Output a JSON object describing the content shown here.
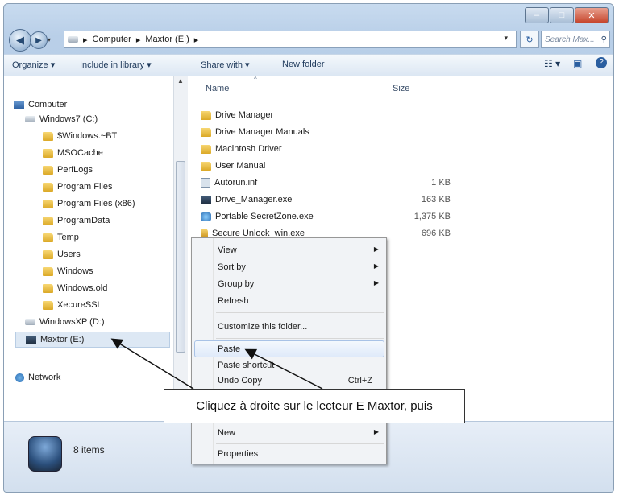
{
  "window": {
    "title_buttons": [
      "minimize",
      "maximize",
      "close"
    ]
  },
  "address_bar": {
    "crumbs": [
      "▸",
      "Computer",
      "▸",
      "Maxtor (E:)",
      "▸"
    ],
    "search_placeholder": "Search Max..."
  },
  "toolbar": {
    "organize": "Organize ▾",
    "include": "Include in library ▾",
    "share": "Share with ▾",
    "new_folder": "New folder"
  },
  "nav": {
    "items": [
      {
        "label": "Computer",
        "icon": "computer-icon"
      },
      {
        "label": "Windows7 (C:)",
        "icon": "drive-icon"
      },
      {
        "label": "$Windows.~BT",
        "icon": "folder-icon"
      },
      {
        "label": "MSOCache",
        "icon": "folder-icon"
      },
      {
        "label": "PerfLogs",
        "icon": "folder-icon"
      },
      {
        "label": "Program Files",
        "icon": "folder-icon"
      },
      {
        "label": "Program Files (x86)",
        "icon": "folder-icon"
      },
      {
        "label": "ProgramData",
        "icon": "folder-icon"
      },
      {
        "label": "Temp",
        "icon": "folder-icon"
      },
      {
        "label": "Users",
        "icon": "folder-icon"
      },
      {
        "label": "Windows",
        "icon": "folder-icon"
      },
      {
        "label": "Windows.old",
        "icon": "folder-icon"
      },
      {
        "label": "XecureSSL",
        "icon": "folder-icon"
      },
      {
        "label": "WindowsXP (D:)",
        "icon": "drive-icon"
      },
      {
        "label": "Maxtor (E:)",
        "icon": "drive-icon"
      },
      {
        "label": "Network",
        "icon": "network-icon"
      }
    ]
  },
  "files": {
    "col_name": "Name",
    "col_size": "Size",
    "rows": [
      {
        "name": "Drive Manager",
        "size": ""
      },
      {
        "name": "Drive Manager Manuals",
        "size": ""
      },
      {
        "name": "Macintosh Driver",
        "size": ""
      },
      {
        "name": "User Manual",
        "size": ""
      },
      {
        "name": "Autorun.inf",
        "size": "1 KB"
      },
      {
        "name": "Drive_Manager.exe",
        "size": "163 KB"
      },
      {
        "name": "Portable SecretZone.exe",
        "size": "1,375 KB"
      },
      {
        "name": "Secure Unlock_win.exe",
        "size": "696 KB"
      }
    ]
  },
  "context_menu": {
    "view": "View",
    "sort_by": "Sort by",
    "group_by": "Group by",
    "refresh": "Refresh",
    "customize": "Customize this folder...",
    "paste": "Paste",
    "paste_shortcut": "Paste shortcut",
    "undo_copy": "Undo Copy",
    "undo_shortcut": "Ctrl+Z",
    "new": "New",
    "properties": "Properties"
  },
  "status": {
    "items": "8 items"
  },
  "callout": {
    "text": "Cliquez à droite sur le lecteur E Maxtor, puis"
  }
}
